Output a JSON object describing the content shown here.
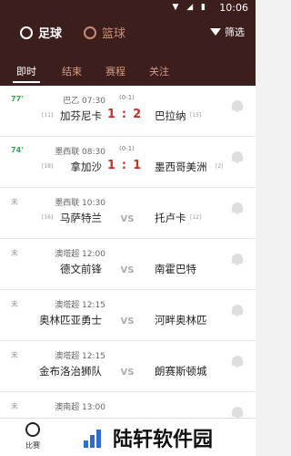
{
  "statusbar": {
    "time": "10:06",
    "icons": "▼ ◢ ▮"
  },
  "header": {
    "sports": [
      {
        "label": "足球",
        "active": true
      },
      {
        "label": "篮球",
        "active": false
      }
    ],
    "filter_label": "筛选"
  },
  "tabs": [
    {
      "label": "即时",
      "active": true
    },
    {
      "label": "结束",
      "active": false
    },
    {
      "label": "赛程",
      "active": false
    },
    {
      "label": "关注",
      "active": false
    }
  ],
  "matches": [
    {
      "status": "77'",
      "live": true,
      "league": "巴乙 07:30",
      "half": "(0-1)",
      "home_rank": "[11]",
      "home": "加芬尼卡",
      "home_score": "1",
      "away_score": "2",
      "away": "巴拉纳",
      "away_rank": "[15]"
    },
    {
      "status": "74'",
      "live": true,
      "league": "墨西联 08:30",
      "half": "(0-1)",
      "home_rank": "[18]",
      "home": "拿加沙",
      "home_score": "1",
      "away_score": "1",
      "away": "墨西哥美洲",
      "away_rank": "[2]"
    },
    {
      "status": "未",
      "live": false,
      "league": "墨西联 10:30",
      "half": "",
      "home_rank": "[16]",
      "home": "马萨特兰",
      "vs": "VS",
      "away": "托卢卡",
      "away_rank": "[12]"
    },
    {
      "status": "未",
      "live": false,
      "league": "澳塔超 12:00",
      "half": "",
      "home_rank": "",
      "home": "德文前锋",
      "vs": "VS",
      "away": "南霍巴特",
      "away_rank": ""
    },
    {
      "status": "未",
      "live": false,
      "league": "澳塔超 12:15",
      "half": "",
      "home_rank": "",
      "home": "奥林匹亚勇士",
      "vs": "VS",
      "away": "河畔奥林匹",
      "away_rank": ""
    },
    {
      "status": "未",
      "live": false,
      "league": "澳塔超 12:15",
      "half": "",
      "home_rank": "",
      "home": "金布洛治狮队",
      "vs": "VS",
      "away": "朗赛斯顿城",
      "away_rank": ""
    },
    {
      "status": "未",
      "live": false,
      "league": "澳南超 13:00",
      "half": "",
      "home_rank": "",
      "home": "",
      "vs": "",
      "away": "",
      "away_rank": ""
    }
  ],
  "bottom_nav": {
    "label": "比赛"
  },
  "watermark": {
    "text": "陆轩软件园"
  }
}
